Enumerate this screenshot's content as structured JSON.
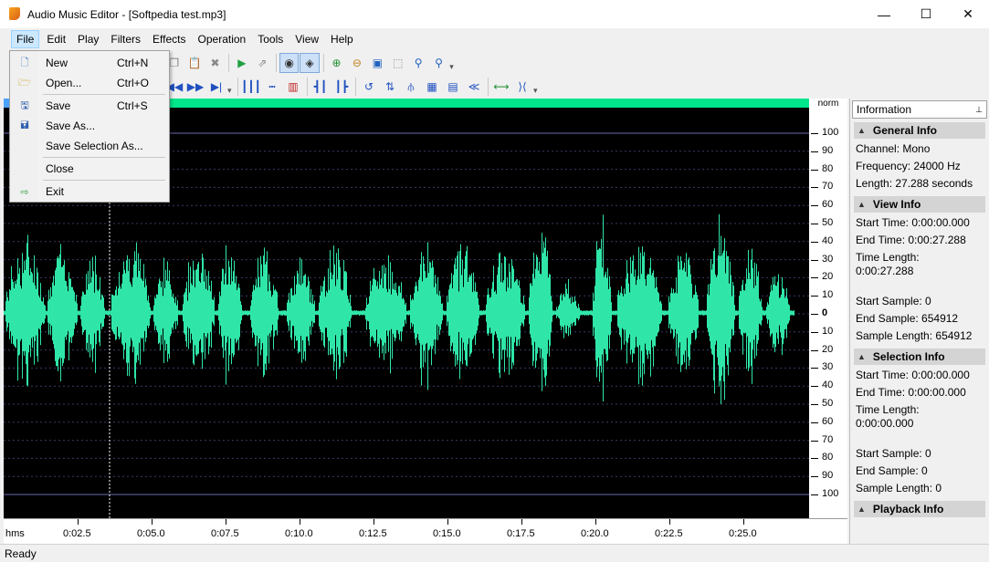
{
  "window": {
    "title": "Audio Music Editor - [Softpedia test.mp3]",
    "minimize": "—",
    "maximize": "☐",
    "close": "✕"
  },
  "menu": [
    "File",
    "Edit",
    "Play",
    "Filters",
    "Effects",
    "Operation",
    "Tools",
    "View",
    "Help"
  ],
  "file_menu": [
    {
      "label": "New",
      "shortcut": "Ctrl+N"
    },
    {
      "label": "Open...",
      "shortcut": "Ctrl+O"
    },
    {
      "label": "Save",
      "shortcut": "Ctrl+S"
    },
    {
      "label": "Save As...",
      "shortcut": ""
    },
    {
      "label": "Save Selection As...",
      "shortcut": ""
    },
    {
      "label": "Close",
      "shortcut": ""
    },
    {
      "label": "Exit",
      "shortcut": ""
    }
  ],
  "scale": {
    "header": "norm",
    "ticks": [
      "100",
      "90",
      "80",
      "70",
      "60",
      "50",
      "40",
      "30",
      "20",
      "10",
      "0",
      "10",
      "20",
      "30",
      "40",
      "50",
      "60",
      "70",
      "80",
      "90",
      "100"
    ]
  },
  "ruler": {
    "unit": "hms",
    "labels": [
      "0:02.5",
      "0:05.0",
      "0:07.5",
      "0:10.0",
      "0:12.5",
      "0:15.0",
      "0:17.5",
      "0:20.0",
      "0:22.5",
      "0:25.0"
    ]
  },
  "info": {
    "title": "Information",
    "pin": "📌",
    "general": {
      "title": "General Info",
      "channel": "Channel: Mono",
      "frequency": "Frequency: 24000 Hz",
      "length": "Length: 27.288 seconds"
    },
    "view": {
      "title": "View Info",
      "start_time": "Start Time: 0:00:00.000",
      "end_time": "End Time: 0:00:27.288",
      "time_length_label": "Time Length:",
      "time_length": "0:00:27.288",
      "start_sample": "Start Sample: 0",
      "end_sample": "End Sample: 654912",
      "sample_length": "Sample Length: 654912"
    },
    "selection": {
      "title": "Selection Info",
      "start_time": "Start Time: 0:00:00.000",
      "end_time": "End Time: 0:00:00.000",
      "time_length_label": "Time Length:",
      "time_length": "0:00:00.000",
      "start_sample": "Start Sample: 0",
      "end_sample": "End Sample: 0",
      "sample_length": "Sample Length: 0"
    },
    "playback": {
      "title": "Playback Info"
    }
  },
  "status": "Ready",
  "colors": {
    "waveform": "#2fe6a8",
    "background": "#000000",
    "grid": "#3a3a6a",
    "selection_bar": "#00e68a"
  },
  "icons": {
    "toolbar1": [
      "paste-icon",
      "delete-icon",
      "insert-icon",
      "export-icon",
      "record-icon",
      "speaker-icon",
      "zoom-in-icon",
      "zoom-out-icon",
      "zoom-fit-icon",
      "zoom-selection-icon",
      "zoom-in-vertical-icon",
      "zoom-out-vertical-icon"
    ],
    "toolbar2": [
      "rewind-icon",
      "fast-forward-icon",
      "skip-end-icon",
      "effect1-icon",
      "effect2-icon",
      "effect3-icon",
      "effect4-icon",
      "effect5-icon",
      "effect6-icon",
      "effect7-icon",
      "effect8-icon",
      "effect9-icon",
      "effect10-icon",
      "effect11-icon",
      "effect12-icon",
      "effect13-icon",
      "effect14-icon"
    ]
  }
}
